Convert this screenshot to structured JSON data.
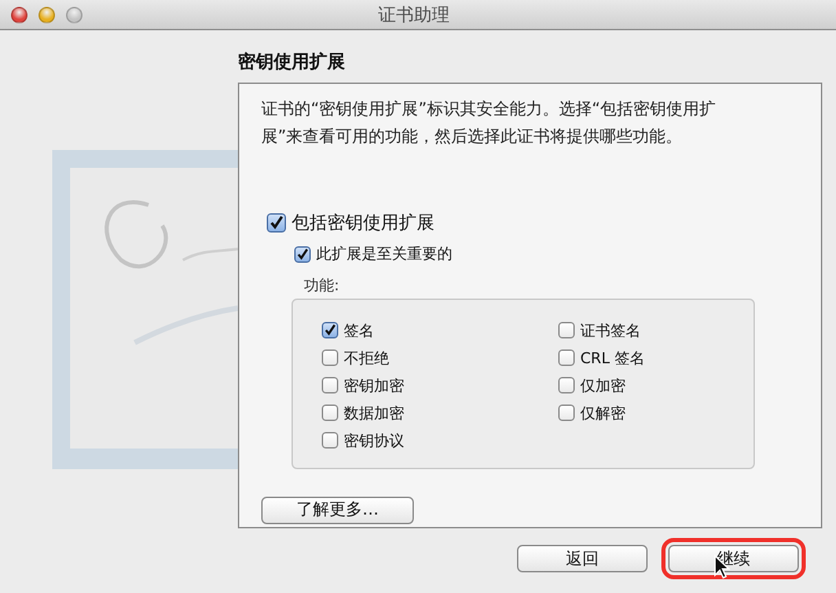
{
  "window": {
    "title": "证书助理"
  },
  "heading": "密钥使用扩展",
  "description": "证书的“密钥使用扩展”标识其安全能力。选择“包括密钥使用扩展”来查看可用的功能，然后选择此证书将提供哪些功能。",
  "include_extension": {
    "label": "包括密钥使用扩展",
    "checked": true
  },
  "critical": {
    "label": "此扩展是至关重要的",
    "checked": true
  },
  "functions_label": "功能:",
  "functions": [
    {
      "label": "签名",
      "checked": true
    },
    {
      "label": "不拒绝",
      "checked": false
    },
    {
      "label": "密钥加密",
      "checked": false
    },
    {
      "label": "数据加密",
      "checked": false
    },
    {
      "label": "密钥协议",
      "checked": false
    },
    {
      "label": "证书签名",
      "checked": false
    },
    {
      "label": "CRL 签名",
      "checked": false
    },
    {
      "label": "仅加密",
      "checked": false
    },
    {
      "label": "仅解密",
      "checked": false
    }
  ],
  "learn_more": "了解更多…",
  "buttons": [
    {
      "label": "返回",
      "highlighted": false
    },
    {
      "label": "继续",
      "highlighted": true
    }
  ]
}
